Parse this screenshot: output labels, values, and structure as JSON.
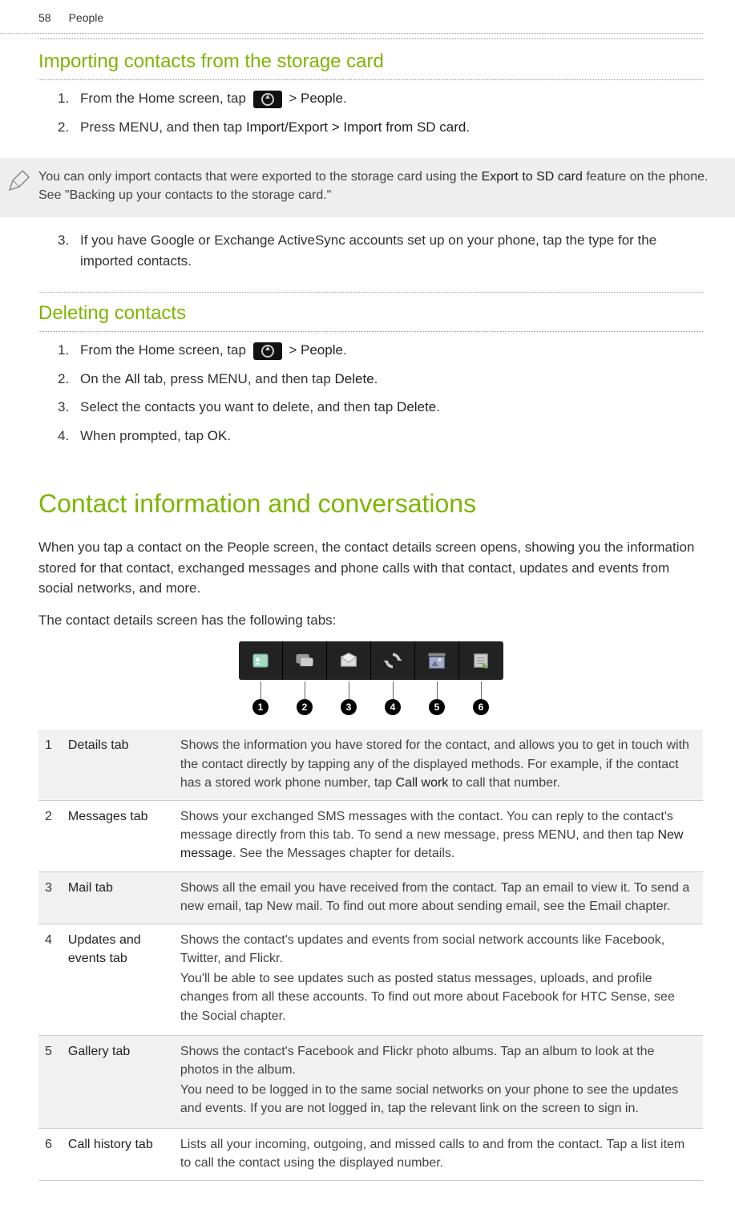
{
  "header": {
    "page_number": "58",
    "section": "People"
  },
  "section1": {
    "title": "Importing contacts from the storage card",
    "steps": [
      {
        "num": "1.",
        "pre": "From the Home screen, tap ",
        "post_gt": " > ",
        "post_bold": "People",
        "post_end": "."
      },
      {
        "num": "2.",
        "text": "Press MENU, and then tap ",
        "bold": "Import/Export > Import from SD card",
        "end": "."
      }
    ],
    "note_pre": "You can only import contacts that were exported to the storage card using the ",
    "note_bold": "Export to SD card",
    "note_post": " feature on the phone. See \"Backing up your contacts to the storage card.\"",
    "step3": {
      "num": "3.",
      "text": "If you have Google or Exchange ActiveSync accounts set up on your phone, tap the type for the imported contacts."
    }
  },
  "section2": {
    "title": "Deleting contacts",
    "steps": [
      {
        "num": "1.",
        "pre": "From the Home screen, tap ",
        "post_gt": " > ",
        "post_bold": "People",
        "post_end": "."
      },
      {
        "num": "2.",
        "t1": "On the ",
        "b1": "All",
        "t2": " tab, press MENU, and then tap ",
        "b2": "Delete",
        "t3": "."
      },
      {
        "num": "3.",
        "t1": "Select the contacts you want to delete, and then tap ",
        "b1": "Delete",
        "t2": "."
      },
      {
        "num": "4.",
        "t1": "When prompted, tap ",
        "b1": "OK",
        "t2": "."
      }
    ]
  },
  "section3": {
    "title": "Contact information and conversations",
    "para1": "When you tap a contact on the People screen, the contact details screen opens, showing you the information stored for that contact, exchanged messages and phone calls with that contact, updates and events from social networks, and more.",
    "para2": "The contact details screen has the following tabs:",
    "callouts": [
      "1",
      "2",
      "3",
      "4",
      "5",
      "6"
    ],
    "tabs": [
      {
        "num": "1",
        "name": "Details tab",
        "desc_parts": [
          {
            "t": "Shows the information you have stored for the contact, and allows you to get in touch with the contact directly by tapping any of the displayed methods. For example, if the contact has a stored work phone number, tap "
          },
          {
            "b": "Call work"
          },
          {
            "t": " to call that number."
          }
        ]
      },
      {
        "num": "2",
        "name": "Messages tab",
        "desc_parts": [
          {
            "t": "Shows your exchanged SMS messages with the contact. You can reply to the contact's message directly from this tab. To send a new message, press MENU, and then tap "
          },
          {
            "b": "New message"
          },
          {
            "t": ". See the Messages chapter for details."
          }
        ]
      },
      {
        "num": "3",
        "name": "Mail tab",
        "desc_parts": [
          {
            "t": "Shows all the email you have received from the contact. Tap an email to view it. To send a new email, tap New mail. To find out more about sending email, see the Email chapter."
          }
        ]
      },
      {
        "num": "4",
        "name": "Updates and events tab",
        "desc_paras": [
          "Shows the contact's updates and events from social network accounts like Facebook, Twitter, and Flickr.",
          "You'll be able to see updates such as posted status messages, uploads, and profile changes from all these accounts. To find out more about Facebook for HTC Sense, see the Social chapter."
        ]
      },
      {
        "num": "5",
        "name": "Gallery tab",
        "desc_paras": [
          "Shows the contact's Facebook and Flickr photo albums. Tap an album to look at the photos in the album.",
          "You need to be logged in to the same social networks on your phone to see the updates and events. If you are not logged in, tap the relevant link on the screen to sign in."
        ]
      },
      {
        "num": "6",
        "name": "Call history tab",
        "desc_parts": [
          {
            "t": "Lists all your incoming, outgoing, and missed calls to and from the contact. Tap a list item to call the contact using the displayed number."
          }
        ]
      }
    ]
  }
}
